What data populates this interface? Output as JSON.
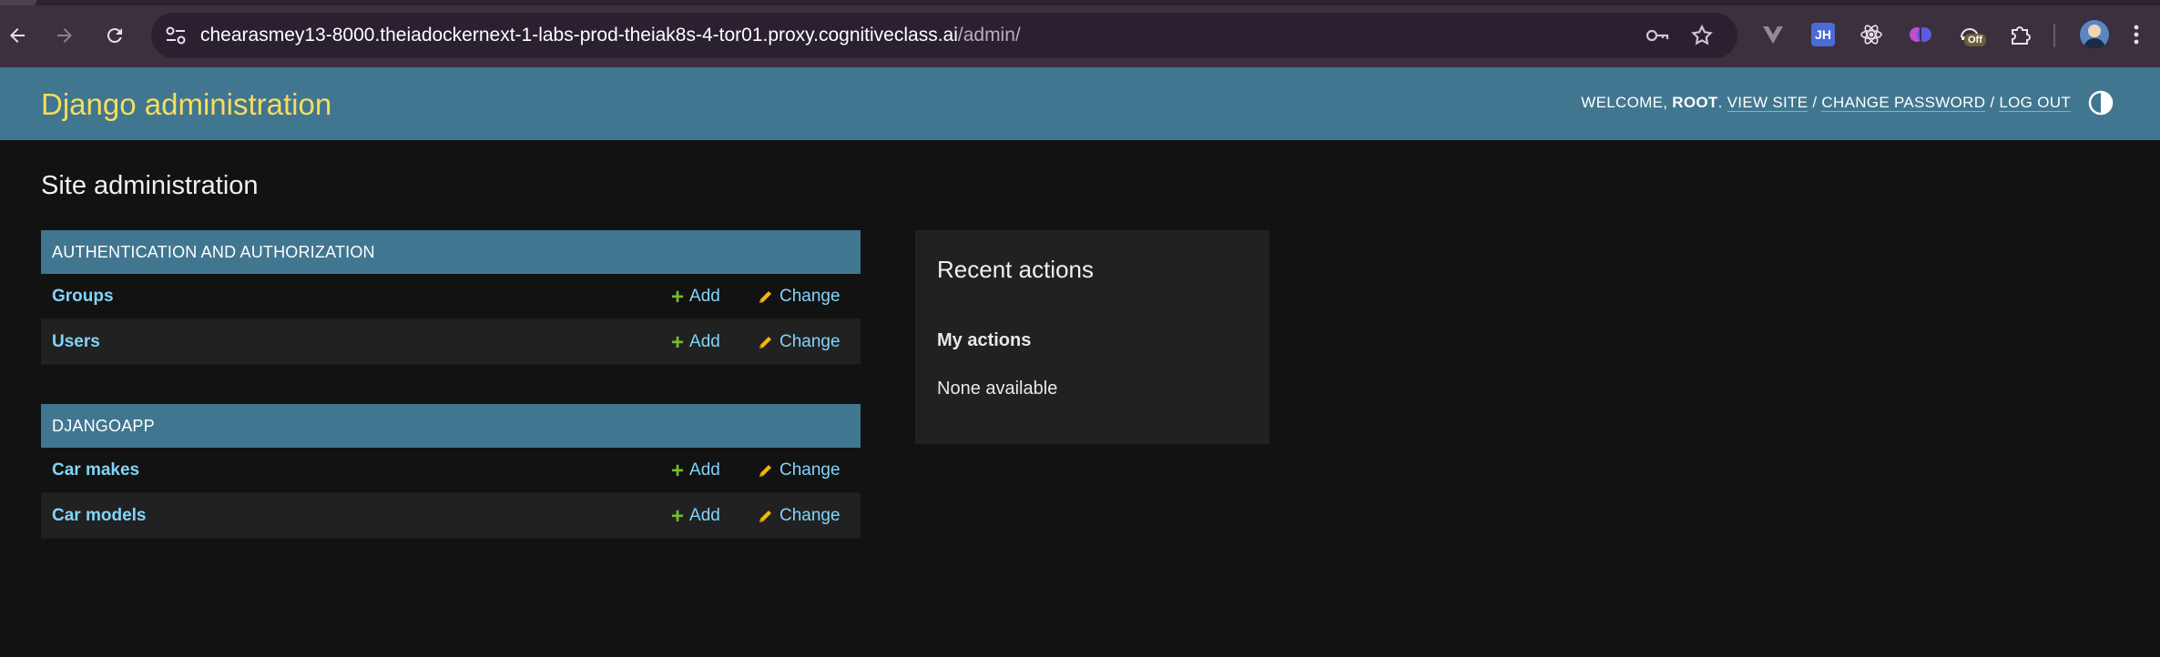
{
  "browser": {
    "url_host": "chearasmey13-8000.theiadockernext-1-labs-prod-theiak8s-4-tor01.proxy.cognitiveclass.ai",
    "url_path": "/admin/",
    "extension_badge": "Off",
    "extension_jh": "JH",
    "icons": [
      "back-arrow-icon",
      "forward-arrow-icon",
      "reload-icon",
      "site-settings-icon",
      "key-icon",
      "star-icon",
      "vue-devtools-icon",
      "jh-extension-icon",
      "react-devtools-icon",
      "brain-extension-icon",
      "off-extension-icon",
      "extensions-puzzle-icon",
      "profile-avatar",
      "menu-dots-icon"
    ]
  },
  "header": {
    "branding": "Django administration",
    "welcome": "Welcome,",
    "username": "root",
    "view_site": "View site",
    "change_password": "Change password",
    "log_out": "Log out",
    "separator": "/"
  },
  "page_title": "Site administration",
  "modules": [
    {
      "caption": "Authentication and Authorization",
      "rows": [
        {
          "name": "Groups",
          "add": "Add",
          "change": "Change"
        },
        {
          "name": "Users",
          "add": "Add",
          "change": "Change"
        }
      ]
    },
    {
      "caption": "Djangoapp",
      "rows": [
        {
          "name": "Car makes",
          "add": "Add",
          "change": "Change"
        },
        {
          "name": "Car models",
          "add": "Add",
          "change": "Change"
        }
      ]
    }
  ],
  "recent_actions": {
    "title": "Recent actions",
    "subtitle": "My actions",
    "empty": "None available"
  },
  "colors": {
    "header_bg": "#417690",
    "branding": "#f5dd5d",
    "link": "#81d4fa",
    "add_plus": "#70bf2b",
    "change_pencil": "#efb80b",
    "body_bg": "#121212"
  }
}
